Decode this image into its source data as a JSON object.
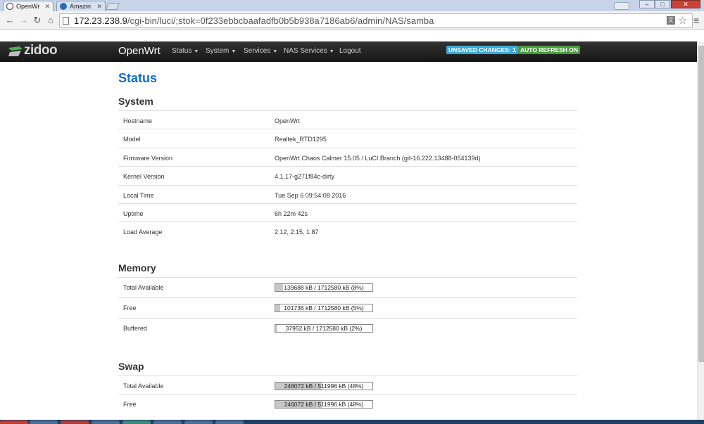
{
  "browser": {
    "tabs": [
      {
        "label": "OpenWr"
      },
      {
        "label": "Amazin"
      }
    ],
    "url_host": "172.23.238.9",
    "url_path": "/cgi-bin/luci/;stok=0f233ebbcbaafadfb0b5b938a7186ab6/admin/NAS/samba"
  },
  "header": {
    "logo_text": "zidoo",
    "brand": "OpenWrt",
    "nav": [
      "Status",
      "System",
      "Services",
      "NAS Services",
      "Logout"
    ],
    "badges": {
      "unsaved": "UNSAVED CHANGES: 1",
      "auto_refresh": "AUTO REFRESH ON"
    },
    "badge_colors": {
      "unsaved": "#3ba8d6",
      "auto_refresh": "#4a9c3e"
    }
  },
  "page": {
    "title": "Status",
    "title_color": "#0f6fc6"
  },
  "system": {
    "title": "System",
    "rows": [
      {
        "key": "Hostname",
        "value": "OpenWrt"
      },
      {
        "key": "Model",
        "value": "Realtek_RTD1295"
      },
      {
        "key": "Firmware Version",
        "value": "OpenWrt Chaos Calmer 15.05 / LuCI Branch (git-16.222.13488-054139d)"
      },
      {
        "key": "Kernel Version",
        "value": "4.1.17-g271f84c-dirty"
      },
      {
        "key": "Local Time",
        "value": "Tue Sep 6 09:54:08 2016"
      },
      {
        "key": "Uptime",
        "value": "6h 22m 42s"
      },
      {
        "key": "Load Average",
        "value": "2.12, 2.15, 1.87"
      }
    ]
  },
  "memory": {
    "title": "Memory",
    "rows": [
      {
        "key": "Total Available",
        "label": "139688 kB / 1712580 kB (8%)",
        "percent": 8
      },
      {
        "key": "Free",
        "label": "101736 kB / 1712580 kB (5%)",
        "percent": 5
      },
      {
        "key": "Buffered",
        "label": "37952 kB / 1712580 kB (2%)",
        "percent": 2
      }
    ]
  },
  "swap": {
    "title": "Swap",
    "rows": [
      {
        "key": "Total Available",
        "label": "246072 kB / 511996 kB (48%)",
        "percent": 48
      },
      {
        "key": "Free",
        "label": "246072 kB / 511996 kB (48%)",
        "percent": 48
      }
    ]
  }
}
